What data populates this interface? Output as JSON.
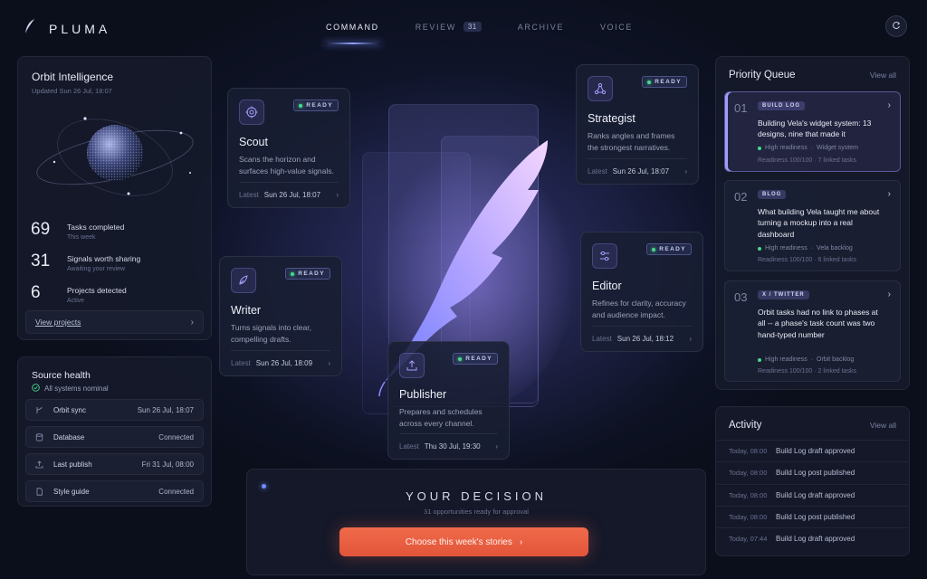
{
  "app": {
    "name": "PLUMA"
  },
  "nav": {
    "items": [
      {
        "label": "COMMAND",
        "active": true
      },
      {
        "label": "REVIEW",
        "badge": "31"
      },
      {
        "label": "ARCHIVE"
      },
      {
        "label": "VOICE"
      }
    ]
  },
  "orbit": {
    "title": "Orbit Intelligence",
    "updated": "Updated Sun 26 Jul, 18:07",
    "stats": [
      {
        "num": "69",
        "label": "Tasks completed",
        "sub": "This week"
      },
      {
        "num": "31",
        "label": "Signals worth sharing",
        "sub": "Awaiting your review"
      },
      {
        "num": "6",
        "label": "Projects detected",
        "sub": "Active"
      }
    ],
    "view_projects": "View projects"
  },
  "source_health": {
    "title": "Source health",
    "status": "All systems nominal",
    "rows": [
      {
        "icon": "branch-icon",
        "label": "Orbit sync",
        "value": "Sun 26 Jul, 18:07"
      },
      {
        "icon": "database-icon",
        "label": "Database",
        "value": "Connected"
      },
      {
        "icon": "upload-icon",
        "label": "Last publish",
        "value": "Fri 31 Jul, 08:00"
      },
      {
        "icon": "document-icon",
        "label": "Style guide",
        "value": "Connected"
      }
    ]
  },
  "agents": {
    "ready_label": "READY",
    "latest_label": "Latest",
    "scout": {
      "name": "Scout",
      "desc": "Scans the horizon and surfaces high-value signals.",
      "latest": "Sun 26 Jul, 18:07"
    },
    "writer": {
      "name": "Writer",
      "desc": "Turns signals into clear, compelling drafts.",
      "latest": "Sun 26 Jul, 18:09"
    },
    "strategist": {
      "name": "Strategist",
      "desc": "Ranks angles and frames the strongest narratives.",
      "latest": "Sun 26 Jul, 18:07"
    },
    "editor": {
      "name": "Editor",
      "desc": "Refines for clarity, accuracy and audience impact.",
      "latest": "Sun 26 Jul, 18:12"
    },
    "publisher": {
      "name": "Publisher",
      "desc": "Prepares and schedules across every channel.",
      "latest": "Thu 30 Jul, 19:30"
    }
  },
  "decision": {
    "title": "YOUR DECISION",
    "sub": "31 opportunities ready for approval",
    "cta": "Choose this week's stories"
  },
  "queue": {
    "title": "Priority Queue",
    "view_all": "View all",
    "items": [
      {
        "num": "01",
        "tag": "BUILD LOG",
        "text": "Building Vela's widget system: 13 designs, nine that made it",
        "readiness": "High readiness",
        "source": "Widget system",
        "detail": "Readiness 100/100 · 7 linked tasks"
      },
      {
        "num": "02",
        "tag": "BLOG",
        "text": "What building Vela taught me about turning a mockup into a real dashboard",
        "readiness": "High readiness",
        "source": "Vela backlog",
        "detail": "Readiness 100/100 · 6 linked tasks"
      },
      {
        "num": "03",
        "tag": "X / TWITTER",
        "text": "Orbit tasks had no link to phases at all -- a phase's task count was two hand-typed number",
        "readiness": "High readiness",
        "source": "Orbit backlog",
        "detail": "Readiness 100/100 · 2 linked tasks"
      }
    ]
  },
  "activity": {
    "title": "Activity",
    "view_all": "View all",
    "rows": [
      {
        "time": "Today, 08:00",
        "text": "Build Log draft approved"
      },
      {
        "time": "Today, 08:00",
        "text": "Build Log post published"
      },
      {
        "time": "Today, 08:00",
        "text": "Build Log draft approved"
      },
      {
        "time": "Today, 08:00",
        "text": "Build Log post published"
      },
      {
        "time": "Today, 07:44",
        "text": "Build Log draft approved"
      }
    ]
  },
  "colors": {
    "accent": "#8fa3ff",
    "cta": "#ea5f42",
    "ready_dot": "#46d98b",
    "background": "#0b0f1c"
  }
}
